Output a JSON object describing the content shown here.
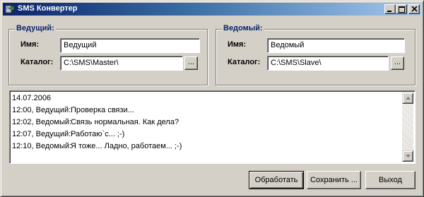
{
  "window": {
    "title": "SMS Конвертер"
  },
  "master": {
    "group_title": "Ведущий:",
    "name_label": "Имя:",
    "name_value": "Ведущий",
    "folder_label": "Каталог:",
    "folder_value": "C:\\SMS\\Master\\",
    "browse_label": "..."
  },
  "slave": {
    "group_title": "Ведомый:",
    "name_label": "Имя:",
    "name_value": "Ведомый",
    "folder_label": "Каталог:",
    "folder_value": "C:\\SMS\\Slave\\",
    "browse_label": "..."
  },
  "log": {
    "date": "14.07.2006",
    "lines": [
      {
        "who": "12:00, Ведущий:",
        "msg": "Проверка связи..."
      },
      {
        "who": "12:02, Ведомый:",
        "msg": "Связь нормальная. Как дела?"
      },
      {
        "who": "12:07, Ведущий:",
        "msg": "Работаю`с... ;-)"
      },
      {
        "who": "12:10, Ведомый:",
        "msg": "Я тоже... Ладно, работаем... ;-)"
      }
    ]
  },
  "buttons": {
    "process": "Обработать",
    "save": "Сохранить ...",
    "exit": "Выход"
  },
  "colors": {
    "title_gradient_start": "#0a246a",
    "title_gradient_end": "#a6caf0",
    "group_title": "#0a246a",
    "face": "#d4d0c8"
  }
}
